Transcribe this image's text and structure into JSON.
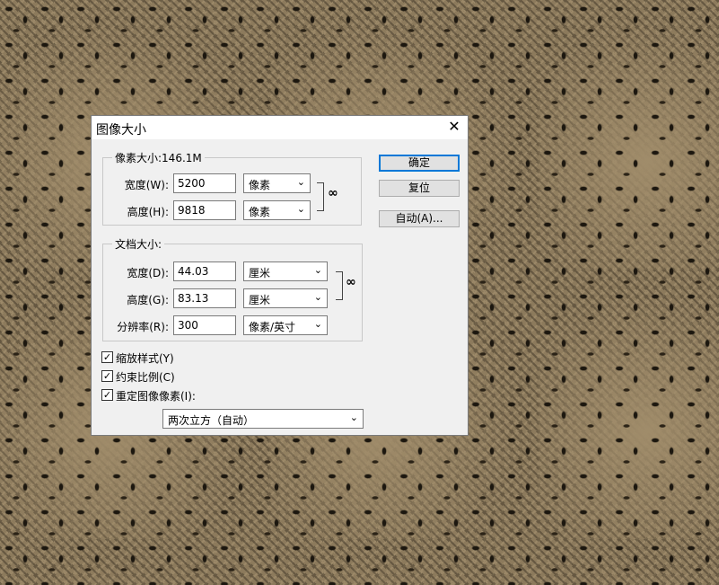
{
  "dialog": {
    "title": "图像大小",
    "close_glyph": "✕"
  },
  "pixel_dimensions": {
    "legend": "像素大小:146.1M",
    "width_label": "宽度(W):",
    "width_value": "5200",
    "width_unit": "像素",
    "height_label": "高度(H):",
    "height_value": "9818",
    "height_unit": "像素"
  },
  "document_size": {
    "legend": "文档大小:",
    "width_label": "宽度(D):",
    "width_value": "44.03",
    "width_unit": "厘米",
    "height_label": "高度(G):",
    "height_value": "83.13",
    "height_unit": "厘米",
    "resolution_label": "分辨率(R):",
    "resolution_value": "300",
    "resolution_unit": "像素/英寸"
  },
  "options": {
    "scale_styles": {
      "label": "缩放样式(Y)",
      "checked": true
    },
    "constrain_proportions": {
      "label": "约束比例(C)",
      "checked": true
    },
    "resample_image": {
      "label": "重定图像像素(I):",
      "checked": true
    },
    "resample_method": "两次立方（自动）"
  },
  "buttons": {
    "ok": "确定",
    "reset": "复位",
    "auto": "自动(A)..."
  },
  "icons": {
    "chain": "chain-link-icon",
    "dropdown": "chevron-down-icon",
    "check": "checkmark-icon"
  }
}
